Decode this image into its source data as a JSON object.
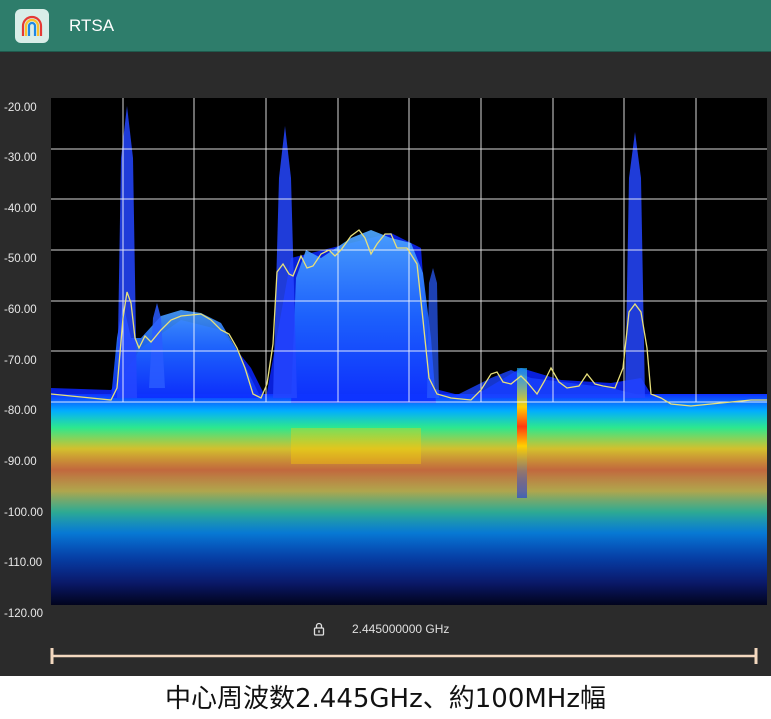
{
  "window": {
    "title": "RTSA"
  },
  "plot": {
    "y_ticks": [
      "-20.00",
      "-30.00",
      "-40.00",
      "-50.00",
      "-60.00",
      "-70.00",
      "-80.00",
      "-90.00",
      "-100.00",
      "-110.00",
      "-120.00"
    ],
    "y_range": [
      -120,
      -20
    ],
    "center_frequency": "2.445000000 GHz",
    "colors": {
      "trace": "#e8e07a",
      "grid": "#ffffff",
      "spectrum_blue": "#1a3cff",
      "band_red": "#ff3a10"
    }
  },
  "icons": {
    "app": "rainbow-arch-icon",
    "lock": "lock-icon"
  },
  "caption": "中心周波数2.445GHz、約100MHz幅"
}
